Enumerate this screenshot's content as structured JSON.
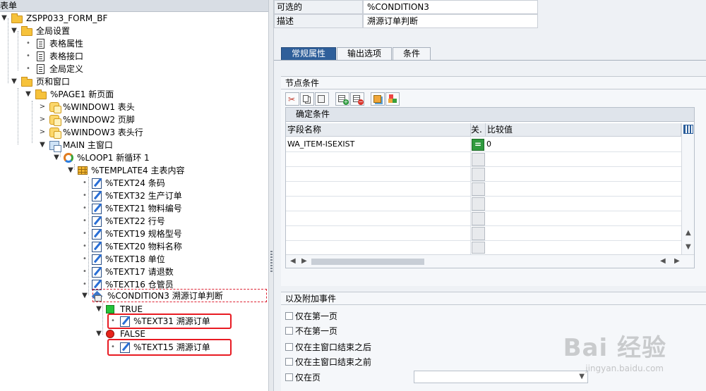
{
  "left_panel": {
    "header": "表单",
    "tree": [
      {
        "label": "ZSPP033_FORM_BF",
        "icon": "folder-icon",
        "toggle": "▼"
      },
      {
        "label": "全局设置",
        "icon": "folder-icon",
        "toggle": "▼"
      },
      {
        "label": "表格属性",
        "icon": "document-icon",
        "toggle": "•"
      },
      {
        "label": "表格接口",
        "icon": "document-icon",
        "toggle": "•"
      },
      {
        "label": "全局定义",
        "icon": "document-icon",
        "toggle": "•"
      },
      {
        "label": "页和窗口",
        "icon": "folder-icon",
        "toggle": "▼"
      },
      {
        "label": "%PAGE1 新页面",
        "icon": "folder-icon",
        "toggle": "▼"
      },
      {
        "label": "%WINDOW1 表头",
        "icon": "window-icon",
        "toggle": ">"
      },
      {
        "label": "%WINDOW2 页脚",
        "icon": "window-icon",
        "toggle": ">"
      },
      {
        "label": "%WINDOW3 表头行",
        "icon": "window-icon",
        "toggle": ">"
      },
      {
        "label": "MAIN 主窗口",
        "icon": "main-window-icon",
        "toggle": "▼"
      },
      {
        "label": "%LOOP1 新循环 1",
        "icon": "loop-icon",
        "toggle": "▼"
      },
      {
        "label": "%TEMPLATE4 主表内容",
        "icon": "table-icon",
        "toggle": "▼"
      },
      {
        "label": "%TEXT24 条码",
        "icon": "text-icon",
        "toggle": "•"
      },
      {
        "label": "%TEXT32 生产订单",
        "icon": "text-icon",
        "toggle": "•"
      },
      {
        "label": "%TEXT21 物料编号",
        "icon": "text-icon",
        "toggle": "•"
      },
      {
        "label": "%TEXT22 行号",
        "icon": "text-icon",
        "toggle": "•"
      },
      {
        "label": "%TEXT19 规格型号",
        "icon": "text-icon",
        "toggle": "•"
      },
      {
        "label": "%TEXT20 物料名称",
        "icon": "text-icon",
        "toggle": "•"
      },
      {
        "label": "%TEXT18 单位",
        "icon": "text-icon",
        "toggle": "•"
      },
      {
        "label": "%TEXT17 请退数",
        "icon": "text-icon",
        "toggle": "•"
      },
      {
        "label": "%TEXT16 仓管员",
        "icon": "text-icon",
        "toggle": "•"
      },
      {
        "label": "%CONDITION3 溯源订单判断",
        "icon": "condition-icon",
        "toggle": "▼"
      },
      {
        "label": "TRUE",
        "icon": "true-icon",
        "toggle": "▼"
      },
      {
        "label": "%TEXT31 溯源订单",
        "icon": "text-icon",
        "toggle": "•"
      },
      {
        "label": "FALSE",
        "icon": "false-icon",
        "toggle": "▼"
      },
      {
        "label": "%TEXT15 溯源订单",
        "icon": "text-icon",
        "toggle": "•"
      }
    ]
  },
  "right_panel": {
    "selectable_label": "可选的",
    "selectable_value": "%CONDITION3",
    "desc_label": "描述",
    "desc_value": "溯源订单判断",
    "tabs": [
      {
        "label": "常规属性",
        "active": true
      },
      {
        "label": "输出选项",
        "active": false
      },
      {
        "label": "条件",
        "active": false
      }
    ],
    "node_conditions": {
      "title": "节点条件",
      "grid_title": "确定条件",
      "columns": [
        "字段名称",
        "关.",
        "比较值"
      ],
      "rows": [
        {
          "field": "WA_ITEM-ISEXIST",
          "op": "=",
          "value": "0"
        },
        {
          "field": "",
          "op": "",
          "value": ""
        },
        {
          "field": "",
          "op": "",
          "value": ""
        },
        {
          "field": "",
          "op": "",
          "value": ""
        },
        {
          "field": "",
          "op": "",
          "value": ""
        },
        {
          "field": "",
          "op": "",
          "value": ""
        },
        {
          "field": "",
          "op": "",
          "value": ""
        },
        {
          "field": "",
          "op": "",
          "value": ""
        }
      ]
    },
    "events": {
      "title": "以及附加事件",
      "options": [
        {
          "label": "仅在第一页",
          "checked": false
        },
        {
          "label": "不在第一页",
          "checked": false
        },
        {
          "label": "仅在主窗口结束之后",
          "checked": false
        },
        {
          "label": "仅在主窗口结束之前",
          "checked": false
        },
        {
          "label": "仅在页",
          "checked": false
        }
      ],
      "page_select_value": ""
    }
  },
  "watermark": {
    "text": "Bai 经验",
    "sub": "jingyan.baidu.com"
  },
  "colors": {
    "tab_active": "#2f5f9a",
    "highlight_box": "#e81b23",
    "op_green": "#2f9a3e"
  }
}
